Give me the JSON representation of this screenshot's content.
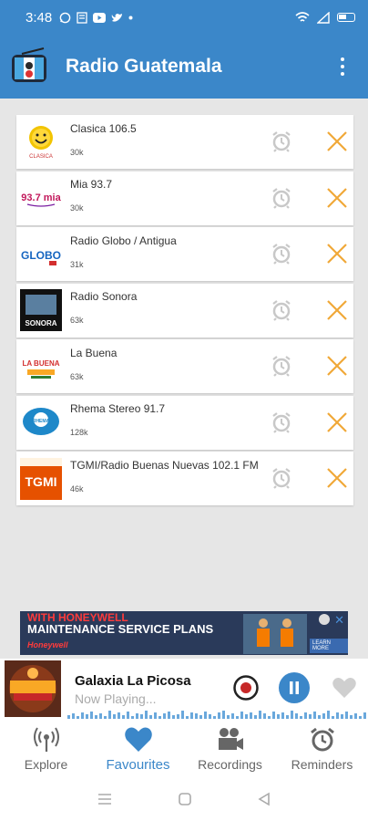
{
  "status_bar": {
    "time": "3:48"
  },
  "app": {
    "title": "Radio Guatemala"
  },
  "stations": [
    {
      "name": "Clasica 106.5",
      "count": "30k",
      "logo_text": "CLASICA"
    },
    {
      "name": "Mia 93.7",
      "count": "30k",
      "logo_text": "93.7 mia"
    },
    {
      "name": "Radio Globo / Antigua",
      "count": "31k",
      "logo_text": "GLOBO"
    },
    {
      "name": "Radio Sonora",
      "count": "63k",
      "logo_text": "SONORA"
    },
    {
      "name": "La Buena",
      "count": "63k",
      "logo_text": "LA BUENA"
    },
    {
      "name": "Rhema Stereo 91.7",
      "count": "128k",
      "logo_text": "RHEMA"
    },
    {
      "name": "TGMI/Radio Buenas Nuevas 102.1 FM",
      "count": "46k",
      "logo_text": "TGMI"
    }
  ],
  "ad": {
    "line1": "WITH HONEYWELL",
    "line2": "MAINTENANCE SERVICE PLANS",
    "brand": "Honeywell",
    "cta": "LEARN MORE"
  },
  "player": {
    "title": "Galaxia La Picosa",
    "subtitle": "Now Playing..."
  },
  "tabs": [
    {
      "label": "Explore",
      "icon": "broadcast-icon"
    },
    {
      "label": "Favourites",
      "icon": "heart-icon"
    },
    {
      "label": "Recordings",
      "icon": "video-camera-icon"
    },
    {
      "label": "Reminders",
      "icon": "alarm-clock-icon"
    }
  ],
  "colors": {
    "primary": "#3b87c9",
    "remove": "#f0a838",
    "alarm_gray": "#c8c8c8"
  }
}
